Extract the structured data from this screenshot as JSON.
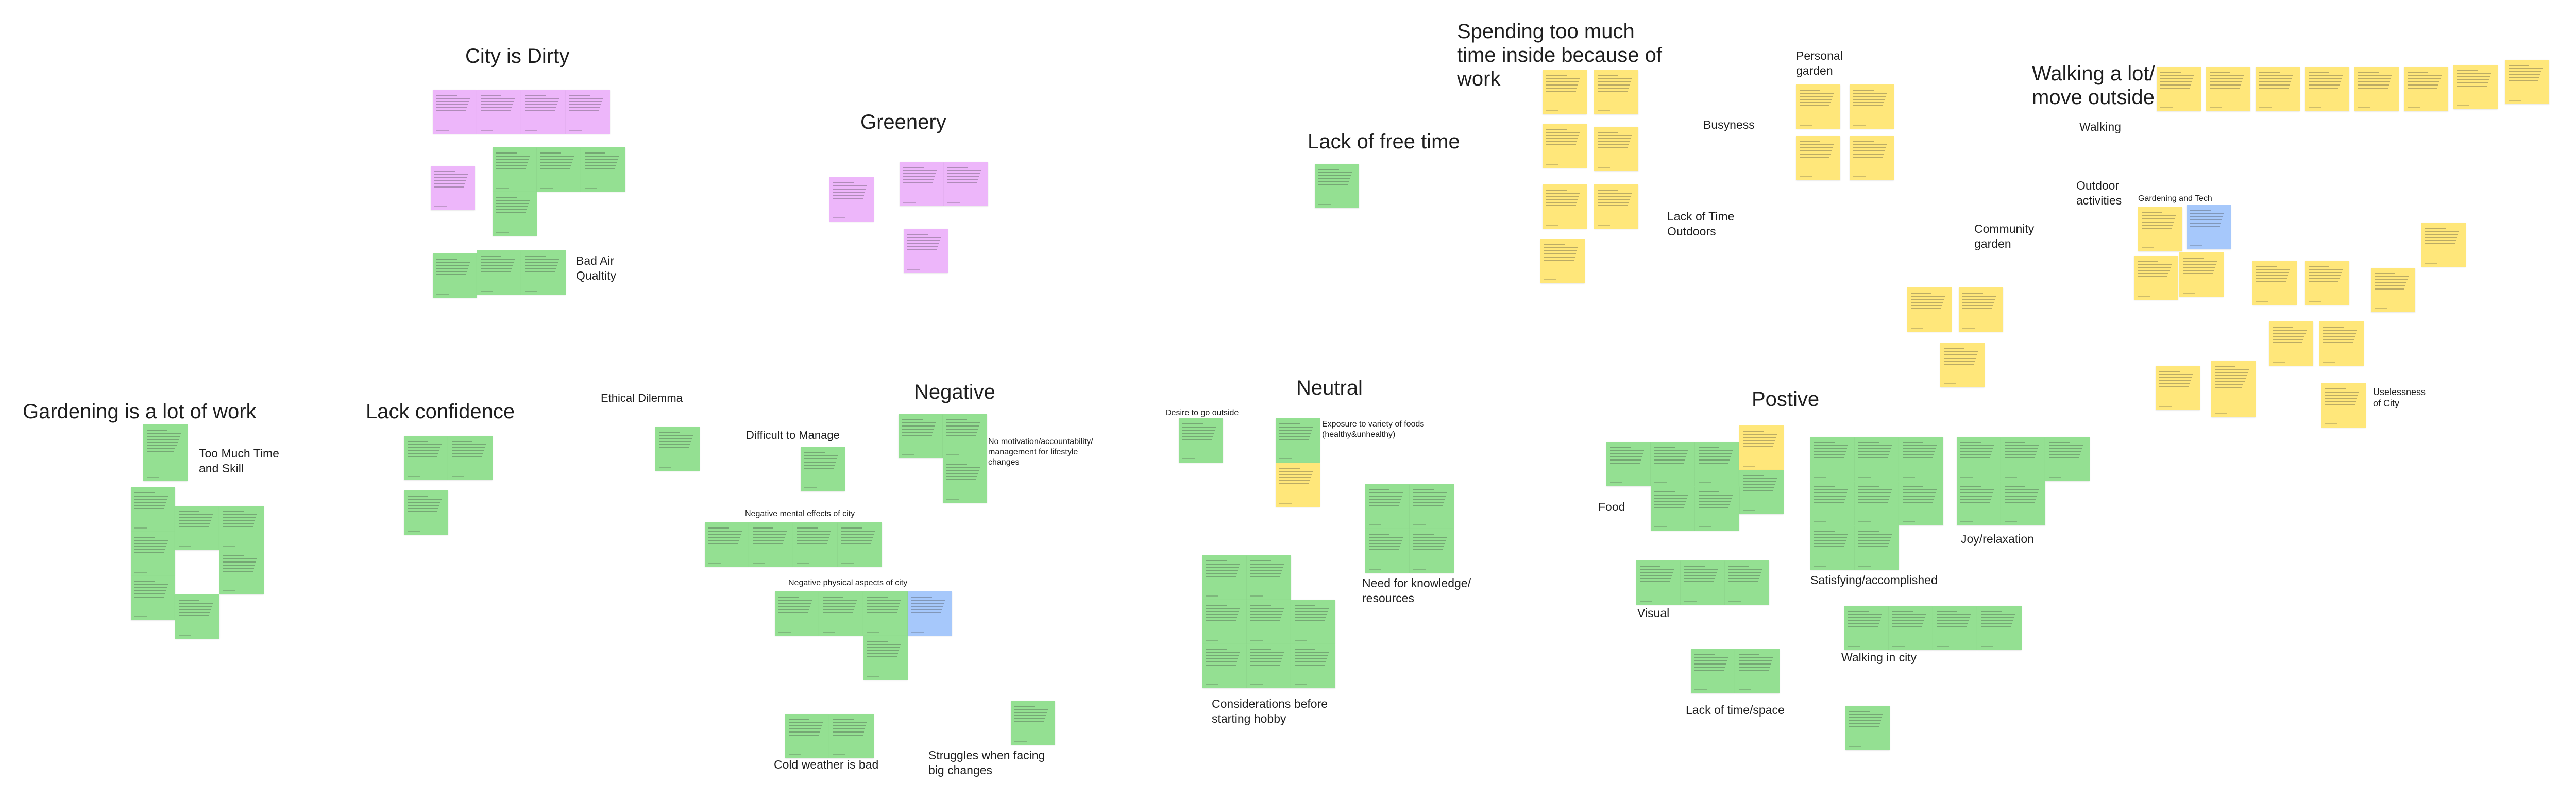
{
  "colors": {
    "green": "#94e092",
    "yellow": "#ffe77a",
    "purple": "#edb6fa",
    "blue": "#a6c8fb",
    "canvas": "#ffffff"
  },
  "headings": {
    "city_is_dirty": "City is Dirty",
    "greenery": "Greenery",
    "lack_of_free_time": "Lack of free time",
    "spending_too_much_time": "Spending too much time inside because of work",
    "walking_a_lot": "Walking a lot/ move outside",
    "gardening_is_work": "Gardening is a lot of work",
    "lack_confidence": "Lack confidence",
    "negative": "Negative",
    "neutral": "Neutral",
    "positive": "Postive"
  },
  "labels": {
    "bad_air_quality": "Bad Air Qualtity",
    "personal_garden": "Personal garden",
    "busyness": "Busyness",
    "lack_of_time_outdoors": "Lack of Time Outdoors",
    "community_garden": "Community garden",
    "walking": "Walking",
    "outdoor_activities": "Outdoor activities",
    "too_much_time_and_skill": "Too Much Time and Skill",
    "food": "Food",
    "visual": "Visual",
    "lack_of_time_space": "Lack of time/space",
    "satisfying": "Satisfying/accomplished",
    "joy_relaxation": "Joy/relaxation",
    "walking_in_city": "Walking in city",
    "need_for_knowledge": "Need for knowledge/ resources",
    "considerations": "Considerations before starting hobby",
    "cold_weather": "Cold weather is bad",
    "struggles": "Struggles when facing big changes",
    "no_motivation": "No motivation/accountability/ management for lifestyle changes",
    "uselessness": "Uselessness of City"
  },
  "small_labels": {
    "ethical_dilemma": "Ethical Dilemma",
    "difficult_to_manage": "Difficult to Manage",
    "negative_mental": "Negative mental effects of city",
    "negative_physical": "Negative physical aspects of city",
    "desire_outside": "Desire to go outside",
    "exposure_foods": "Exposure to variety of foods (healthy&unhealthy)",
    "gardening_and_tech": "Gardening and Tech"
  }
}
